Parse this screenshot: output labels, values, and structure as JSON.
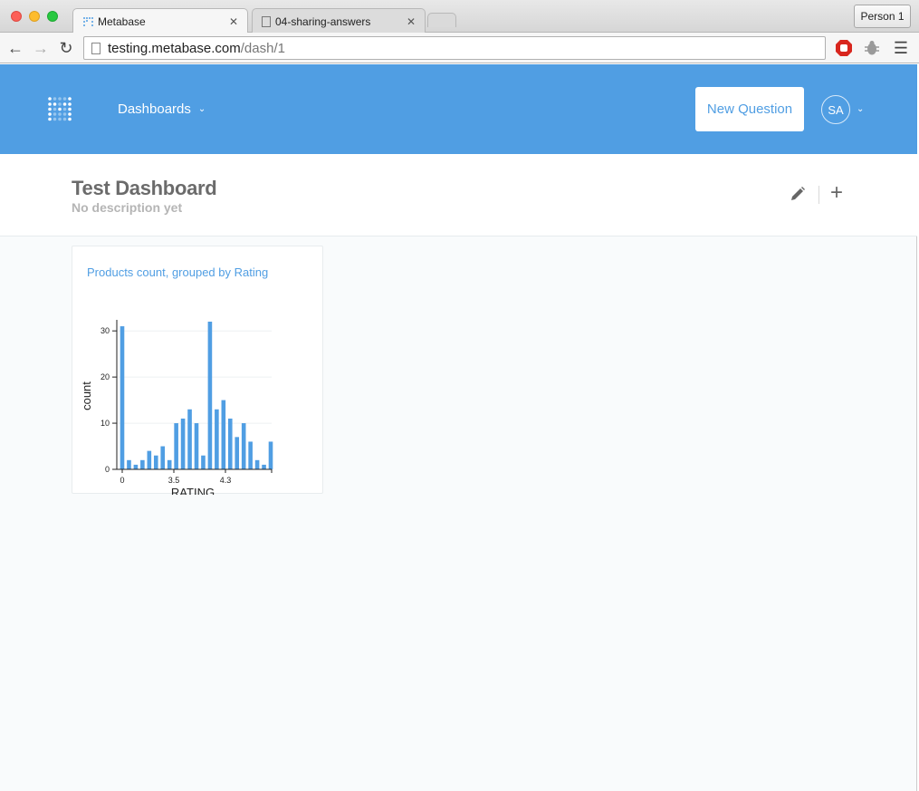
{
  "browser": {
    "tabs": [
      {
        "label": "Metabase",
        "active": true
      },
      {
        "label": "04-sharing-answers",
        "active": false
      }
    ],
    "profile_button": "Person 1",
    "url_host": "testing.metabase.com",
    "url_path": "/dash/1"
  },
  "nav": {
    "dashboards_label": "Dashboards",
    "new_question_label": "New Question",
    "avatar_initials": "SA",
    "accent_color": "#509ee3"
  },
  "dashboard": {
    "title": "Test Dashboard",
    "description": "No description yet"
  },
  "card": {
    "title": "Products count, grouped by Rating"
  },
  "chart_data": {
    "type": "bar",
    "xlabel": "RATING",
    "ylabel": "count",
    "ylim": [
      0,
      32
    ],
    "yticks": [
      0,
      10,
      20,
      30
    ],
    "xtick_labels": [
      "0",
      "3.5",
      "4.3"
    ],
    "bar_color": "#509ee3",
    "values": [
      31,
      2,
      1,
      2,
      4,
      3,
      5,
      2,
      10,
      11,
      13,
      10,
      3,
      32,
      13,
      15,
      11,
      7,
      10,
      6,
      2,
      1,
      6
    ]
  }
}
